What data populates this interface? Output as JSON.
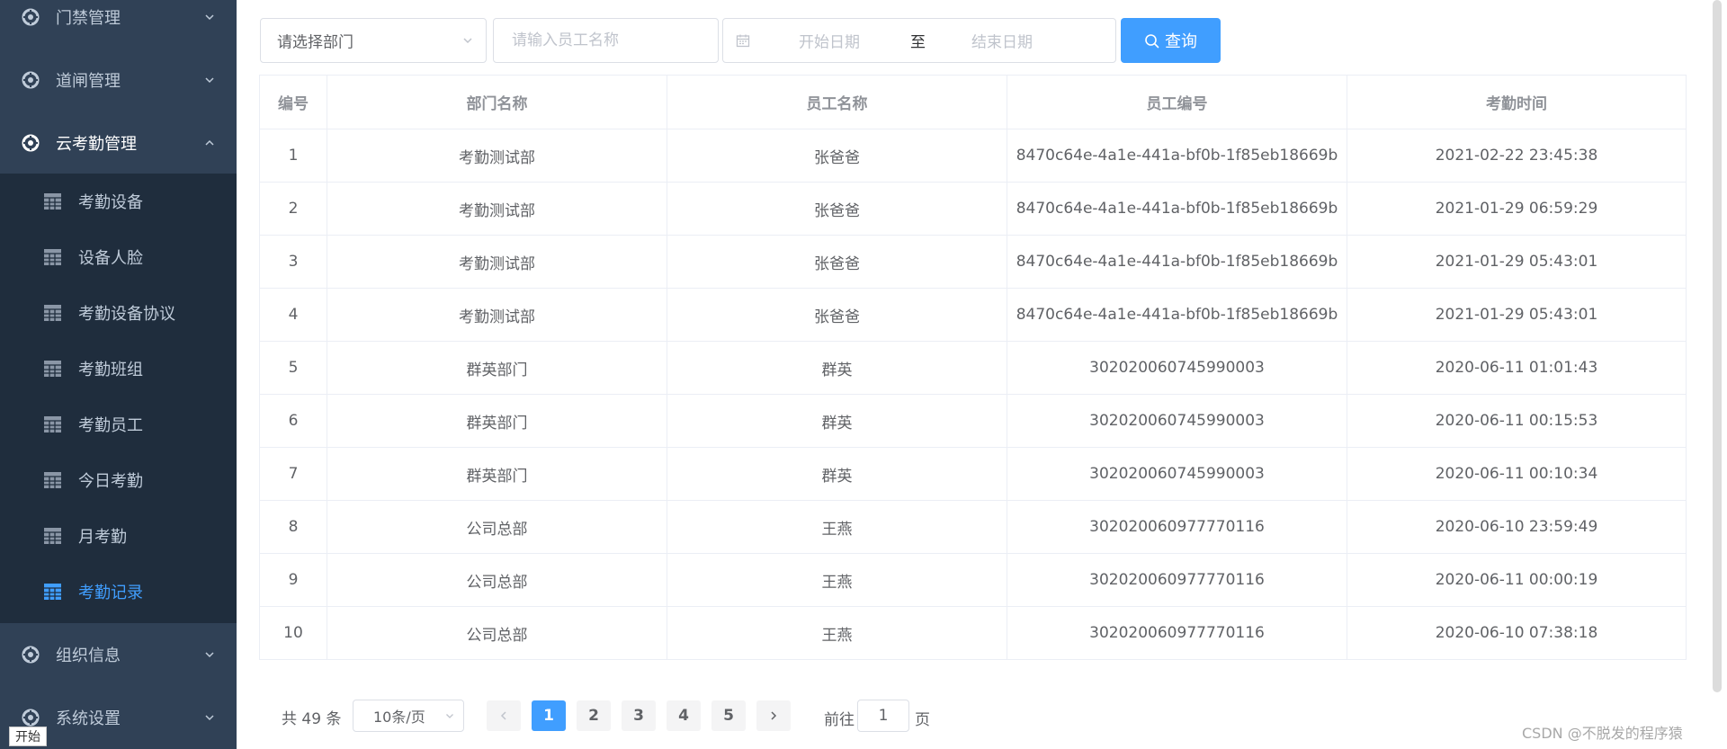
{
  "sidebar": {
    "menu_top": [
      {
        "label": "门禁管理",
        "icon": "aperture-icon",
        "expanded": false
      },
      {
        "label": "道闸管理",
        "icon": "aperture-icon",
        "expanded": false
      },
      {
        "label": "云考勤管理",
        "icon": "aperture-icon",
        "expanded": true
      }
    ],
    "submenu": [
      {
        "label": "考勤设备",
        "icon": "grid-icon",
        "active": false
      },
      {
        "label": "设备人脸",
        "icon": "grid-icon",
        "active": false
      },
      {
        "label": "考勤设备协议",
        "icon": "grid-icon",
        "active": false
      },
      {
        "label": "考勤班组",
        "icon": "grid-icon",
        "active": false
      },
      {
        "label": "考勤员工",
        "icon": "grid-icon",
        "active": false
      },
      {
        "label": "今日考勤",
        "icon": "grid-icon",
        "active": false
      },
      {
        "label": "月考勤",
        "icon": "grid-icon",
        "active": false
      },
      {
        "label": "考勤记录",
        "icon": "grid-icon",
        "active": true
      }
    ],
    "menu_bottom": [
      {
        "label": "组织信息",
        "icon": "aperture-icon",
        "expanded": false
      },
      {
        "label": "系统设置",
        "icon": "aperture-icon",
        "expanded": false
      }
    ],
    "colors": {
      "bg": "#304156",
      "submenu_bg": "#1f2d3d",
      "text": "#bfcbd9",
      "active": "#409eff"
    }
  },
  "taskbar": {
    "start_label": "开始"
  },
  "filters": {
    "department_select": "请选择部门",
    "employee_name_placeholder": "请输入员工名称",
    "start_date_placeholder": "开始日期",
    "range_separator": "至",
    "end_date_placeholder": "结束日期",
    "query_button": "查询"
  },
  "table": {
    "columns": [
      "编号",
      "部门名称",
      "员工名称",
      "员工编号",
      "考勤时间"
    ],
    "rows": [
      [
        "1",
        "考勤测试部",
        "张爸爸",
        "8470c64e-4a1e-441a-bf0b-1f85eb18669b",
        "2021-02-22 23:45:38"
      ],
      [
        "2",
        "考勤测试部",
        "张爸爸",
        "8470c64e-4a1e-441a-bf0b-1f85eb18669b",
        "2021-01-29 06:59:29"
      ],
      [
        "3",
        "考勤测试部",
        "张爸爸",
        "8470c64e-4a1e-441a-bf0b-1f85eb18669b",
        "2021-01-29 05:43:01"
      ],
      [
        "4",
        "考勤测试部",
        "张爸爸",
        "8470c64e-4a1e-441a-bf0b-1f85eb18669b",
        "2021-01-29 05:43:01"
      ],
      [
        "5",
        "群英部门",
        "群英",
        "302020060745990003",
        "2020-06-11 01:01:43"
      ],
      [
        "6",
        "群英部门",
        "群英",
        "302020060745990003",
        "2020-06-11 00:15:53"
      ],
      [
        "7",
        "群英部门",
        "群英",
        "302020060745990003",
        "2020-06-11 00:10:34"
      ],
      [
        "8",
        "公司总部",
        "王燕",
        "302020060977770116",
        "2020-06-10 23:59:49"
      ],
      [
        "9",
        "公司总部",
        "王燕",
        "302020060977770116",
        "2020-06-11 00:00:19"
      ],
      [
        "10",
        "公司总部",
        "王燕",
        "302020060977770116",
        "2020-06-10 07:38:18"
      ]
    ]
  },
  "pagination": {
    "total_text": "共 49 条",
    "page_size": "10条/页",
    "pages": [
      "1",
      "2",
      "3",
      "4",
      "5"
    ],
    "current_page": "1",
    "goto_prefix": "前往",
    "goto_value": "1",
    "goto_suffix": "页"
  },
  "watermark": "CSDN @不脱发的程序猿",
  "accent_color": "#409eff"
}
